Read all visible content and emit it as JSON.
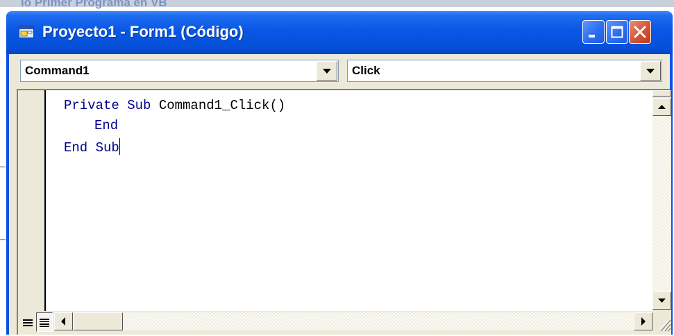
{
  "background": {
    "behind_title": "ıo Primer Programa en VB"
  },
  "window": {
    "title": "Proyecto1 - Form1 (Código)",
    "icons": {
      "app": "form-icon",
      "minimize": "minimize-icon",
      "maximize": "maximize-icon",
      "close": "close-icon"
    },
    "colors": {
      "titlebar": "#0550d8",
      "close_button": "#d35638",
      "client": "#ece9d8"
    }
  },
  "selectors": {
    "object": {
      "value": "Command1",
      "icon": "chevron-down-icon"
    },
    "procedure": {
      "value": "Click",
      "icon": "chevron-down-icon"
    }
  },
  "code": {
    "keyword_color": "#00008b",
    "line1": {
      "kw1": "Private Sub",
      "ident": " Command1_Click()"
    },
    "line2": {
      "kw": "End"
    },
    "line3": {
      "kw": "End Sub"
    }
  },
  "scrollbars": {
    "vertical": {
      "up_icon": "arrow-up-icon",
      "down_icon": "arrow-down-icon",
      "thumb_position": 0
    },
    "horizontal": {
      "left_icon": "arrow-left-icon",
      "right_icon": "arrow-right-icon",
      "thumb_position": 0
    }
  },
  "view_buttons": {
    "procedure_view": "procedure-view-icon",
    "full_module_view": "full-module-view-icon"
  }
}
